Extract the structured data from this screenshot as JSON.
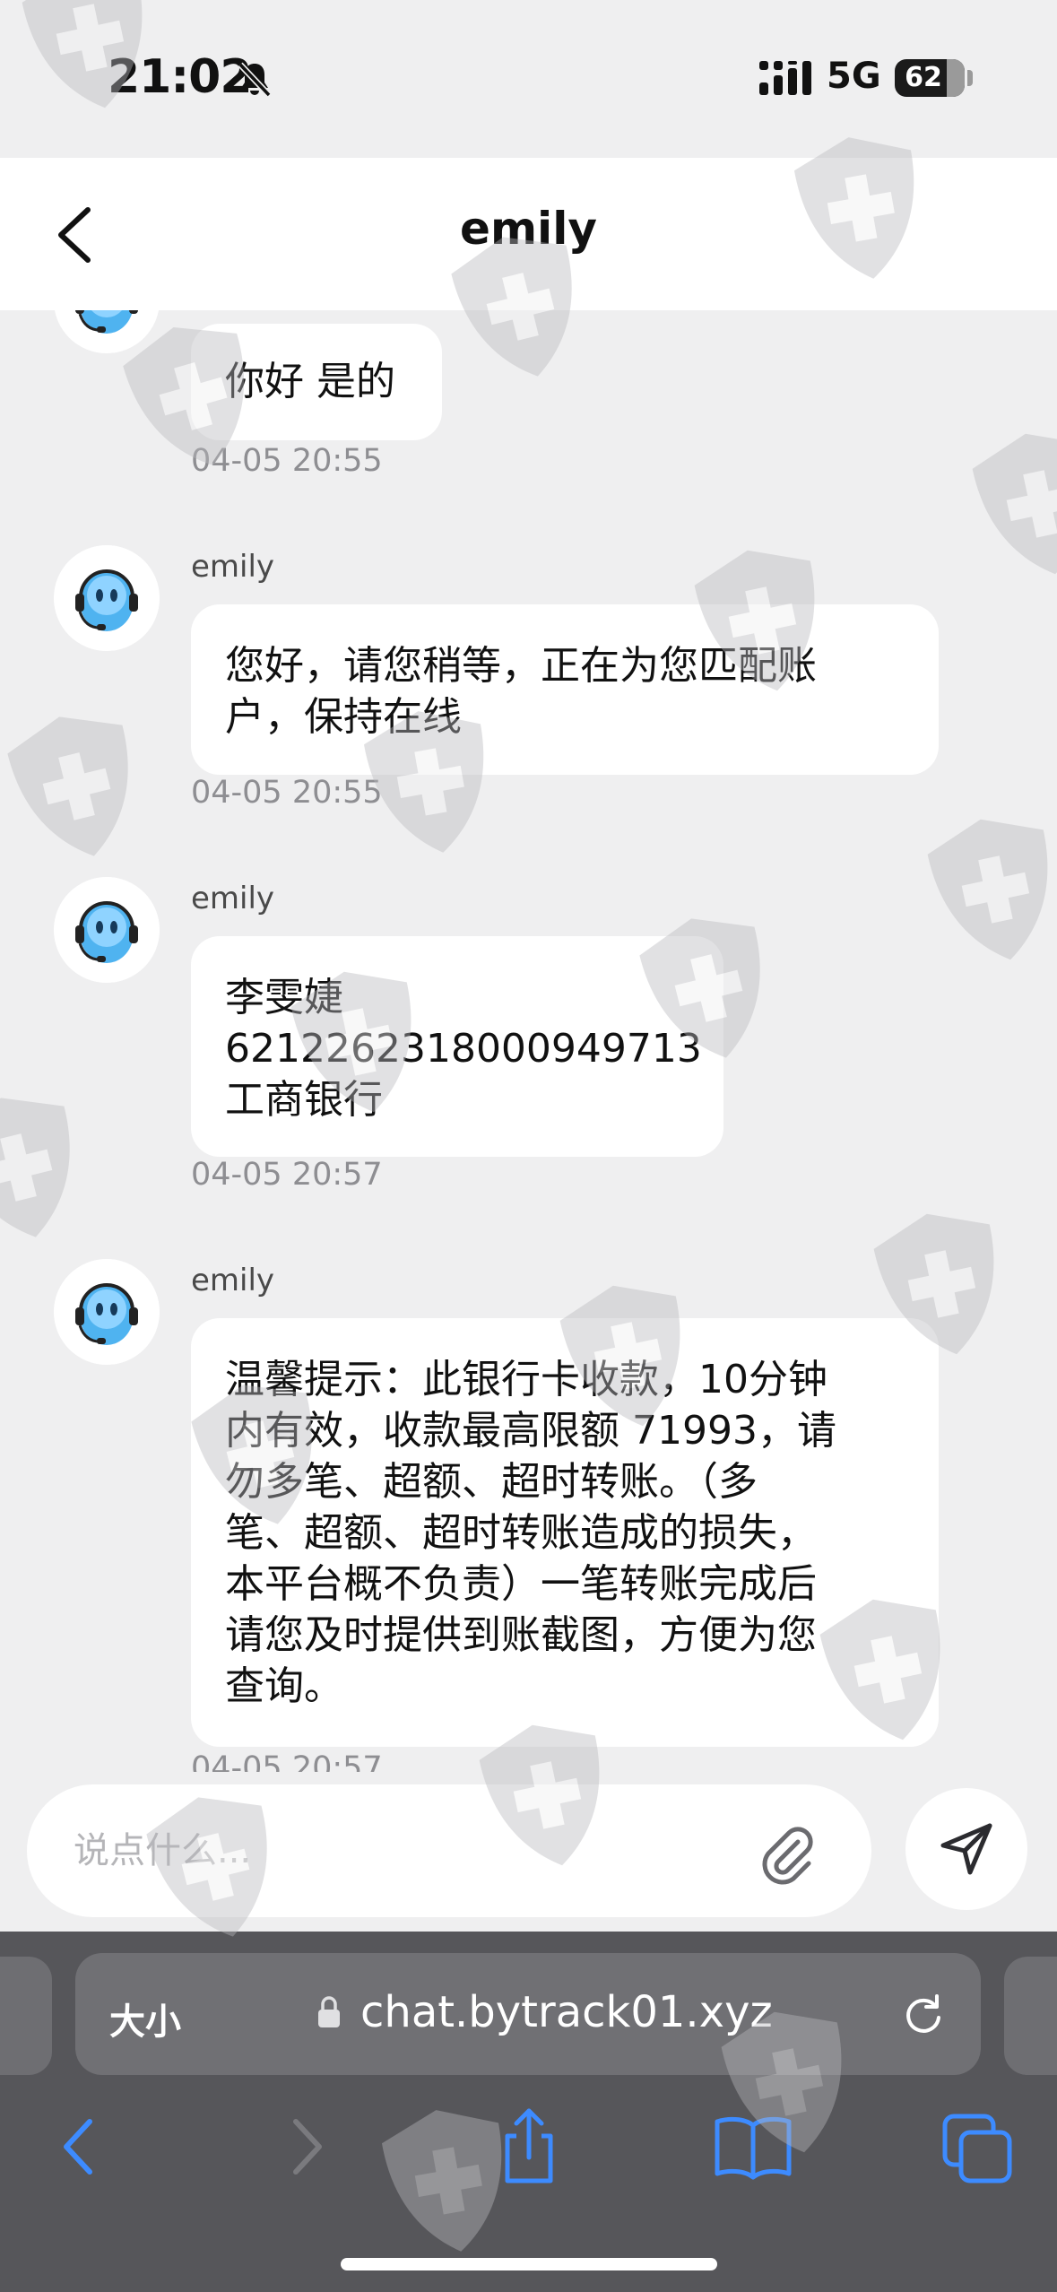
{
  "status_bar": {
    "time": "21:02",
    "network": "5G",
    "battery": "62"
  },
  "header": {
    "title": "emily"
  },
  "messages": [
    {
      "sender": "",
      "lines": [
        "你好 是的"
      ],
      "time": "04-05 20:55"
    },
    {
      "sender": "emily",
      "lines": [
        "您好，请您稍等，正在为您匹配账",
        "户，保持在线"
      ],
      "time": "04-05 20:55"
    },
    {
      "sender": "emily",
      "lines": [
        "李雯婕",
        "6212262318000949713",
        "工商银行"
      ],
      "time": "04-05 20:57"
    },
    {
      "sender": "emily",
      "lines": [
        "温馨提示：此银行卡收款，10分钟",
        "内有效，收款最高限额 71993，请",
        "勿多笔、超额、超时转账。（多",
        "笔、超额、超时转账造成的损失，",
        "本平台概不负责）一笔转账完成后",
        "请您及时提供到账截图，方便为您",
        "查询。"
      ],
      "time": "04-05 20:57"
    }
  ],
  "composer": {
    "placeholder": "说点什么..."
  },
  "browser": {
    "aa_label": "大小",
    "url": "chat.bytrack01.xyz"
  },
  "icons": {
    "back": "chevron-left-icon",
    "bell": "bell-slash-icon",
    "attach": "paperclip-icon",
    "send": "send-icon",
    "lock": "lock-icon",
    "reload": "reload-icon",
    "nav_back": "chevron-left-icon",
    "nav_forward": "chevron-right-icon",
    "share": "share-icon",
    "bookmarks": "book-icon",
    "tabs": "tabs-icon"
  },
  "colors": {
    "background": "#efeff0",
    "bubble": "#ffffff",
    "browser_chrome": "#56565a",
    "accent_blue": "#3d8bff"
  }
}
